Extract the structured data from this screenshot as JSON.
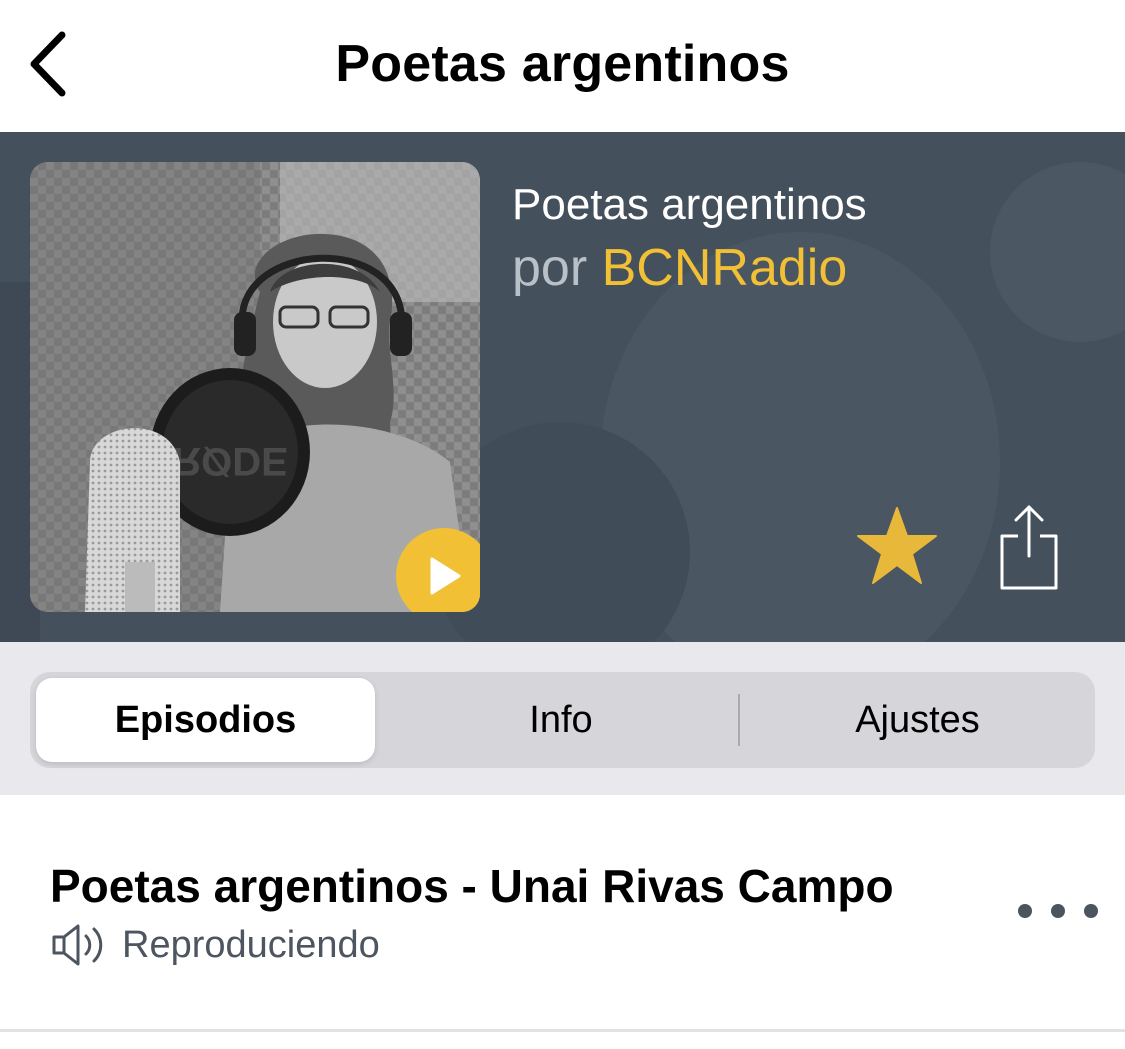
{
  "nav": {
    "back_icon": "chevron-left-icon",
    "title": "Poetas argentinos"
  },
  "podcast": {
    "title": "Poetas argentinos",
    "by_label": "por",
    "author": "BCNRadio",
    "artwork_text": "RØDE",
    "play_icon": "play-icon",
    "favorite_icon": "star-icon",
    "share_icon": "share-icon"
  },
  "tabs": [
    {
      "label": "Episodios",
      "selected": true
    },
    {
      "label": "Info",
      "selected": false
    },
    {
      "label": "Ajustes",
      "selected": false
    }
  ],
  "episodes": [
    {
      "title": "Poetas argentinos - Unai Rivas Campo",
      "status": "Reproduciendo",
      "status_icon": "speaker-icon",
      "more_icon": "more-icon"
    }
  ],
  "colors": {
    "accent": "#f2c035",
    "header_bg": "#44505c",
    "segment_bg": "#d5d5da",
    "status_text": "#4c5560"
  }
}
